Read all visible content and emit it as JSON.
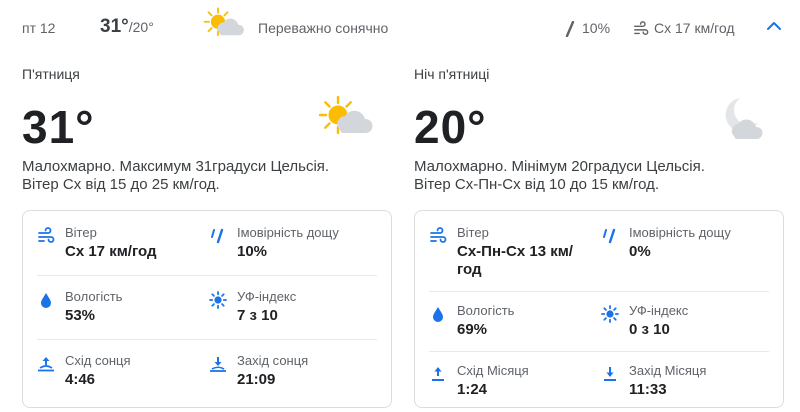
{
  "summary": {
    "day": "пт 12",
    "high": "31°",
    "low": "/20°",
    "condition": "Переважно сонячно",
    "precip": "10%",
    "wind": "Сх 17 км/год",
    "icons": {
      "weather": "partly-sunny-icon",
      "rain": "raindrop-icon",
      "wind": "wind-icon",
      "collapse": "chevron-up-icon"
    }
  },
  "day": {
    "title": "П'ятниця",
    "temp": "31°",
    "desc_line1": "Малохмарно. Максимум 31градуси Цельсія.",
    "desc_line2": "Вітер Сх від 15 до 25 км/год.",
    "details": {
      "wind_label": "Вітер",
      "wind_value": "Сх 17 км/год",
      "rain_label": "Імовірність дощу",
      "rain_value": "10%",
      "humidity_label": "Вологість",
      "humidity_value": "53%",
      "uv_label": "УФ-індекс",
      "uv_value": "7 з 10",
      "rise_label": "Схід сонця",
      "rise_value": "4:46",
      "set_label": "Захід сонця",
      "set_value": "21:09"
    }
  },
  "night": {
    "title": "Ніч п'ятниці",
    "temp": "20°",
    "desc_line1": "Малохмарно. Мінімум 20градуси Цельсія.",
    "desc_line2": "Вітер Сх-Пн-Сх від 10 до 15 км/год.",
    "details": {
      "wind_label": "Вітер",
      "wind_value_line1": "Сх-Пн-Сх 13 км/",
      "wind_value_line2": "год",
      "rain_label": "Імовірність дощу",
      "rain_value": "0%",
      "humidity_label": "Вологість",
      "humidity_value": "69%",
      "uv_label": "УФ-індекс",
      "uv_value": "0 з 10",
      "rise_label": "Схід Місяця",
      "rise_value": "1:24",
      "set_label": "Захід Місяця",
      "set_value": "11:33"
    }
  },
  "colors": {
    "accent": "#1a73e8",
    "sun": "#fbbc04",
    "cloud": "#d3d6db",
    "moon": "#e3e5e8"
  }
}
